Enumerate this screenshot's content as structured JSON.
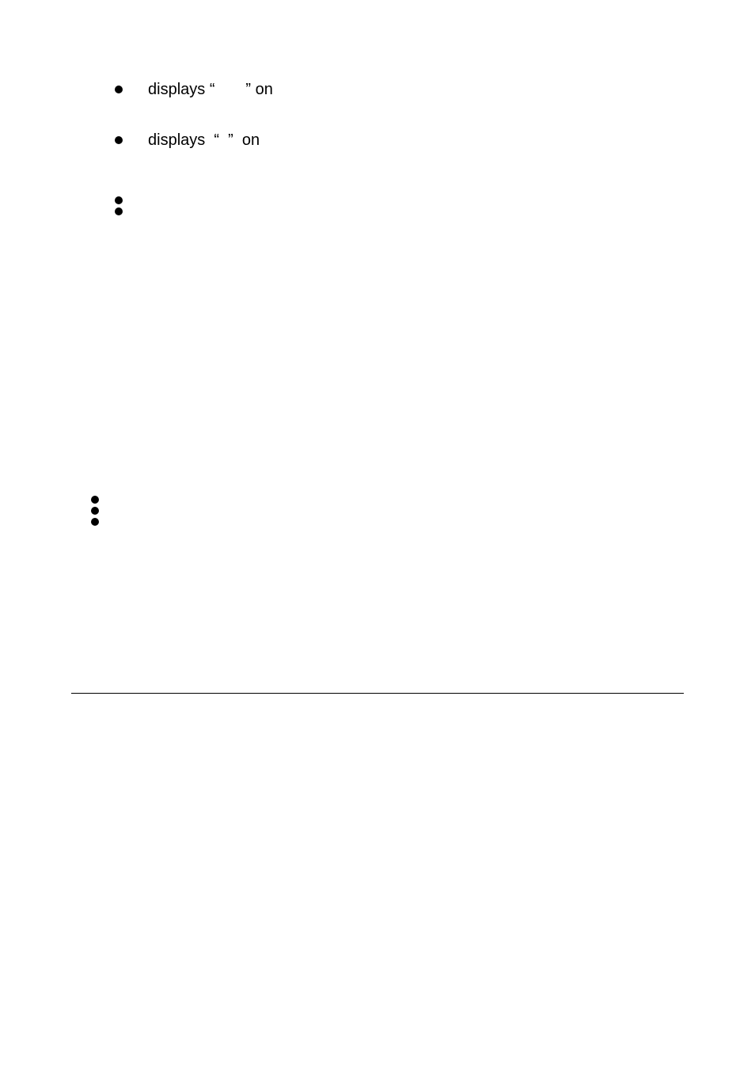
{
  "list1": {
    "items": [
      "displays “       ” on",
      "displays  “  ”  on"
    ]
  },
  "list2": {
    "items": [
      "",
      ""
    ]
  },
  "list3": {
    "items": [
      "",
      "",
      ""
    ]
  }
}
